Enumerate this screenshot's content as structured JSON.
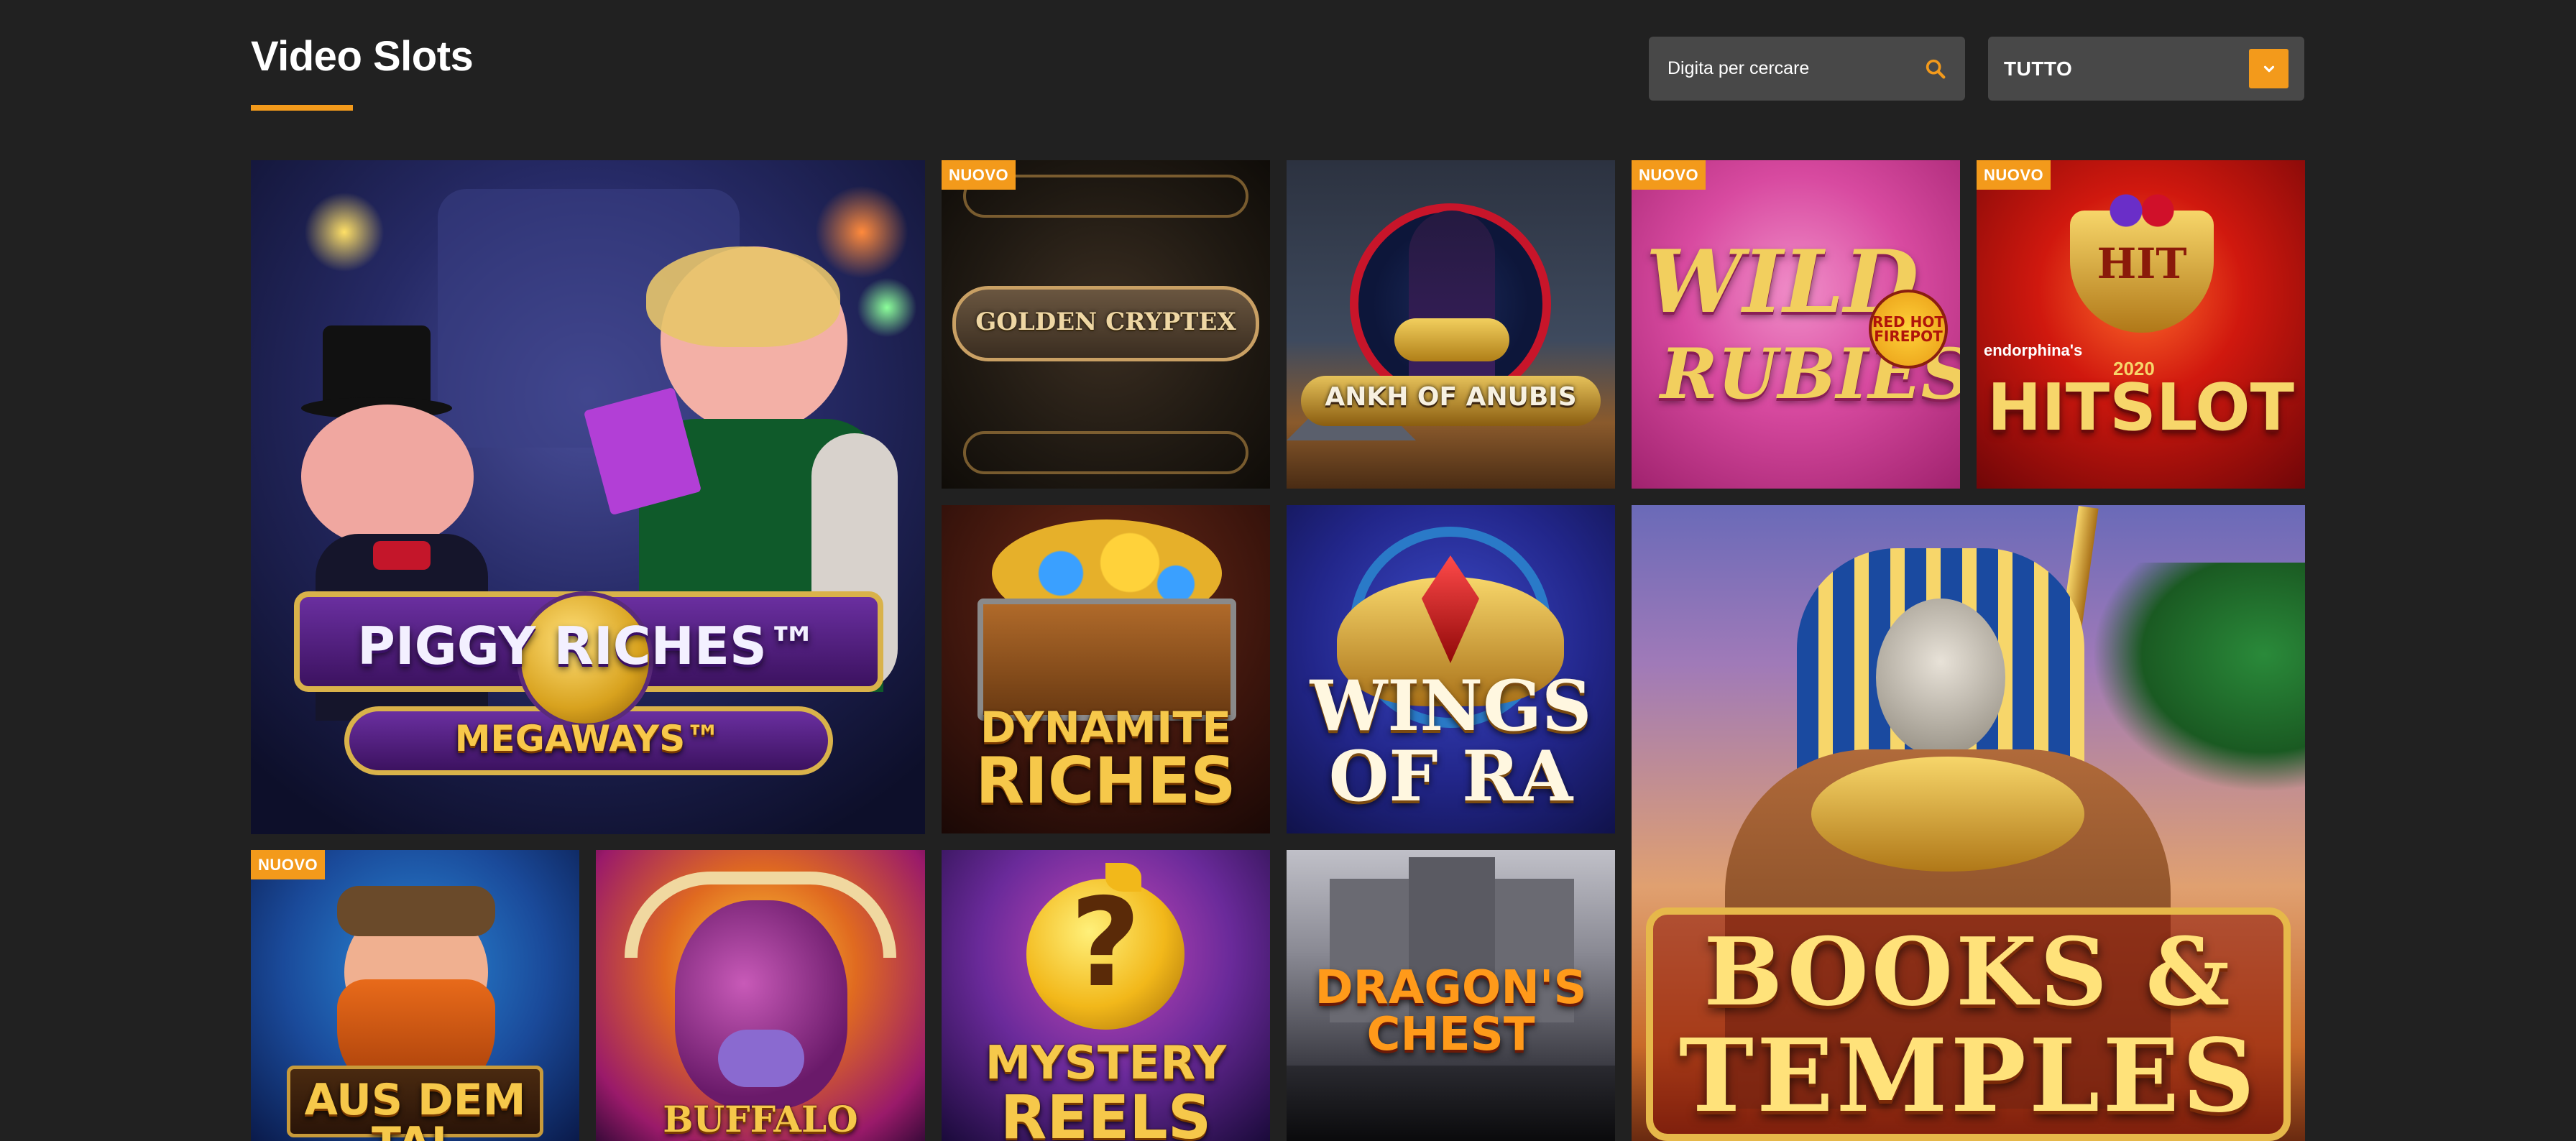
{
  "page": {
    "title": "Video Slots"
  },
  "search": {
    "placeholder": "Digita per cercare"
  },
  "filter": {
    "selected": "TUTTO"
  },
  "badge_text": "NUOVO",
  "accent_color": "#f39a1b",
  "games": [
    {
      "id": "piggy",
      "name_line1": "PIGGY RICHES™",
      "name_line2": "MEGAWAYS™",
      "new": false
    },
    {
      "id": "golden-cryptex",
      "name_line1": "GOLDEN CRYPTEX",
      "new": true
    },
    {
      "id": "ankh",
      "name_line1": "ANKH OF ANUBIS",
      "new": false
    },
    {
      "id": "wild-rubies",
      "name_line1": "WILD",
      "name_line2": "RUBIES",
      "extra": "RED HOT FIREPOT",
      "new": true
    },
    {
      "id": "hitslot",
      "name_line1": "HITSLOT",
      "extra": "endorphina's",
      "extra2": "HIT",
      "extra3": "2020",
      "new": true
    },
    {
      "id": "dynamite",
      "name_line1": "DYNAMITE",
      "name_line2": "RICHES",
      "new": false
    },
    {
      "id": "wings",
      "name_line1": "WINGS",
      "name_line2": "OF RA",
      "new": false
    },
    {
      "id": "books",
      "name_line1": "BOOKS &",
      "name_line2": "TEMPLES",
      "new": false
    },
    {
      "id": "aus-dem-tal",
      "name_line1": "AUS DEM TAL",
      "new": true
    },
    {
      "id": "buffalo",
      "name_line1": "BUFFALO KING™",
      "new": false
    },
    {
      "id": "mystery",
      "name_line1": "MYSTERY",
      "name_line2": "REELS",
      "extra": "?",
      "new": false
    },
    {
      "id": "dragon",
      "name_line1": "DRAGON'S",
      "name_line2": "CHEST",
      "new": false
    }
  ]
}
